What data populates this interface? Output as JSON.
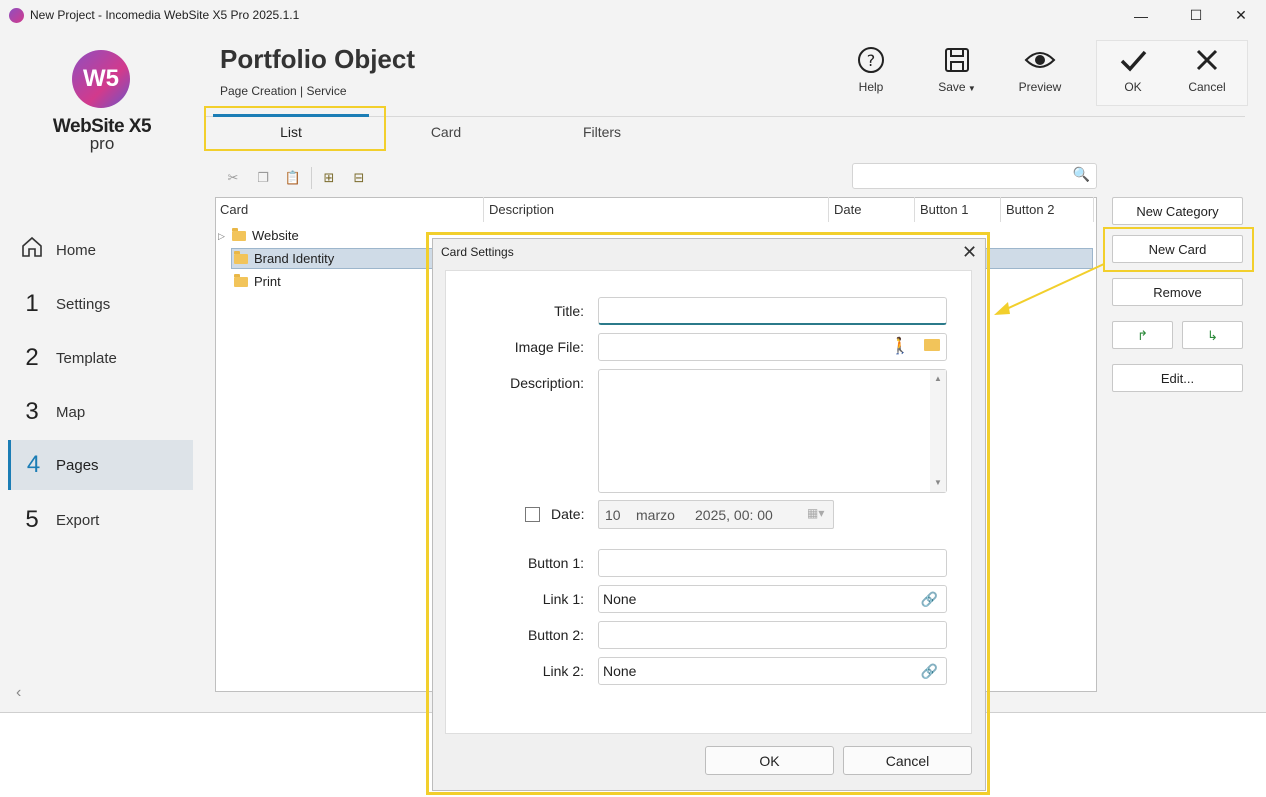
{
  "window": {
    "title": "New Project - Incomedia WebSite X5 Pro 2025.1.1"
  },
  "app_logo": {
    "glyph": "W5",
    "name": "WebSite X5",
    "edition": "pro"
  },
  "sidebar": {
    "items": [
      {
        "num": "",
        "label": "Home"
      },
      {
        "num": "1",
        "label": "Settings"
      },
      {
        "num": "2",
        "label": "Template"
      },
      {
        "num": "3",
        "label": "Map"
      },
      {
        "num": "4",
        "label": "Pages"
      },
      {
        "num": "5",
        "label": "Export"
      }
    ],
    "active": "Pages",
    "collapse": "‹"
  },
  "header": {
    "title": "Portfolio Object",
    "breadcrumb": "Page Creation | Service",
    "help": "Help",
    "save": "Save",
    "preview": "Preview",
    "ok": "OK",
    "cancel": "Cancel"
  },
  "tabs": [
    {
      "label": "List",
      "active": true
    },
    {
      "label": "Card",
      "active": false
    },
    {
      "label": "Filters",
      "active": false
    }
  ],
  "table": {
    "columns": [
      "Card",
      "Description",
      "Date",
      "Button 1",
      "Button 2"
    ],
    "rows": [
      {
        "label": "Website",
        "expandable": true,
        "selected": false
      },
      {
        "label": "Brand Identity",
        "expandable": false,
        "selected": true
      },
      {
        "label": "Print",
        "expandable": false,
        "selected": false
      }
    ]
  },
  "side_buttons": {
    "new_category": "New Category",
    "new_card": "New Card",
    "remove": "Remove",
    "edit": "Edit..."
  },
  "dialog": {
    "title": "Card Settings",
    "fields": {
      "title_label": "Title:",
      "image_label": "Image File:",
      "description_label": "Description:",
      "date_label": "Date:",
      "date_day": "10",
      "date_month": "marzo",
      "date_rest": "2025, 00: 00",
      "button1_label": "Button 1:",
      "link1_label": "Link 1:",
      "link1_value": "None",
      "button2_label": "Button 2:",
      "link2_label": "Link 2:",
      "link2_value": "None"
    },
    "ok": "OK",
    "cancel": "Cancel"
  },
  "colors": {
    "accent": "#1b7db5",
    "highlight": "#f2cf2c",
    "selection": "#cfdbe7"
  }
}
